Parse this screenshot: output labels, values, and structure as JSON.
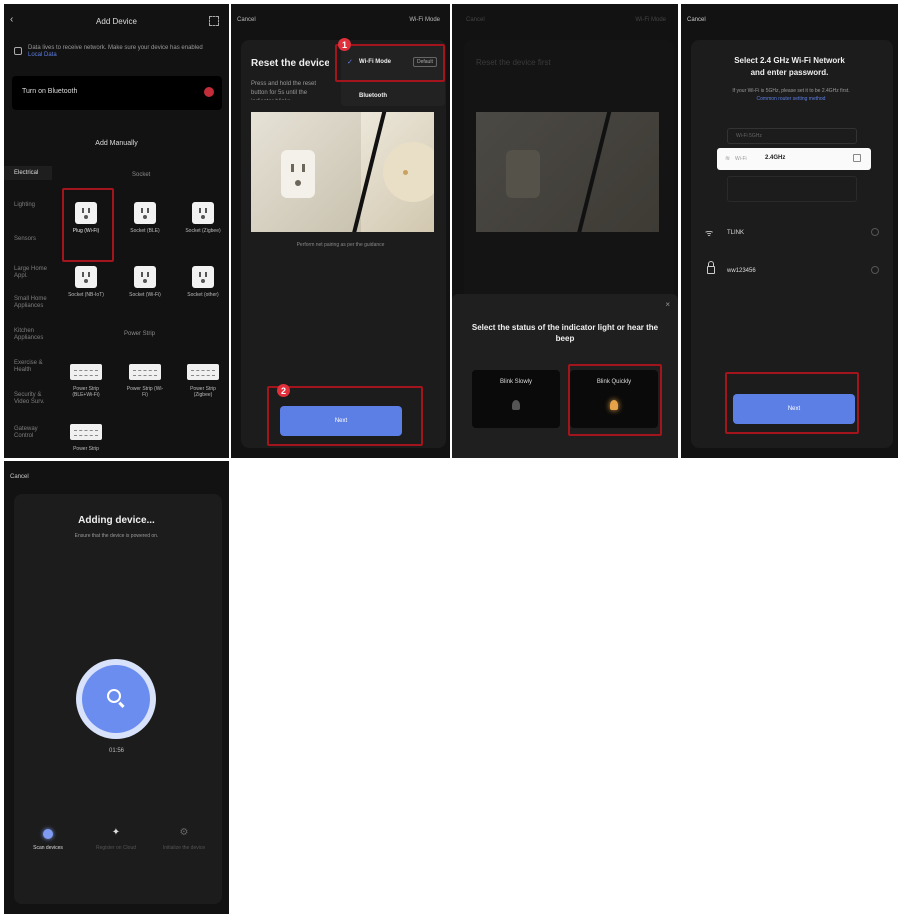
{
  "p1": {
    "title": "Add Device",
    "notice": "Data lives to receive network. Make sure your device has enabled ",
    "notice_link": "Local Data",
    "bluetooth": "Turn on Bluetooth",
    "section": "Add Manually",
    "sidebar": [
      "Electrical",
      "Lighting",
      "Sensors",
      "Large Home Appl.",
      "Small Home Appliances",
      "Kitchen Appliances",
      "Exercise & Health",
      "Security & Video Surv.",
      "Gateway Control"
    ],
    "group1": "Socket",
    "row1": [
      "Plug (Wi-Fi)",
      "Socket (BLE)",
      "Socket (Zigbee)"
    ],
    "row2": [
      "Socket (NB-IoT)",
      "Socket (Wi-Fi)",
      "Socket (other)"
    ],
    "group2": "Power Strip",
    "row3": [
      "Power Strip (BLE+Wi-Fi)",
      "Power Strip (Wi-Fi)",
      "Power Strip (Zigbee)"
    ],
    "row4": [
      "Power Strip"
    ]
  },
  "p2": {
    "cancel": "Cancel",
    "mode": "Wi-Fi Mode",
    "title": "Reset the device",
    "desc": "Press and hold the reset button for 5s until the indicator blinks",
    "menu_wifi": "Wi-Fi Mode",
    "menu_wifi_tag": "Default",
    "menu_bt": "Bluetooth",
    "caption": "Perform net pairing as per the guidance",
    "next": "Next",
    "badge1": "1",
    "badge2": "2"
  },
  "p3": {
    "cancel": "Cancel",
    "mode": "Wi-Fi Mode",
    "title": "Reset the device first",
    "question": "Select the status of the indicator light or hear the beep",
    "opt_slow": "Blink Slowly",
    "opt_quick": "Blink Quickly"
  },
  "p4": {
    "cancel": "Cancel",
    "title_line1": "Select 2.4 GHz Wi-Fi Network",
    "title_line2": "and enter password.",
    "hint": "If your Wi-Fi is 5GHz, please set it to be 2.4GHz first.",
    "hint_link": "Common router setting method",
    "band_5": "Wi-Fi 5GHz",
    "band_24": "Wi-Fi",
    "band_24_value": "2.4GHz",
    "ssid": "TLINK",
    "password": "ww123456",
    "next": "Next"
  },
  "p5": {
    "cancel": "Cancel",
    "title": "Adding device...",
    "subtitle": "Ensure that the device is powered on.",
    "timer": "01:56",
    "steps": [
      "Scan devices",
      "Register on Cloud",
      "Initialize the device"
    ]
  },
  "colors": {
    "accent": "#5c7fe6",
    "highlight": "#a3141c",
    "badge": "#e0303b",
    "panel": "#121212"
  }
}
